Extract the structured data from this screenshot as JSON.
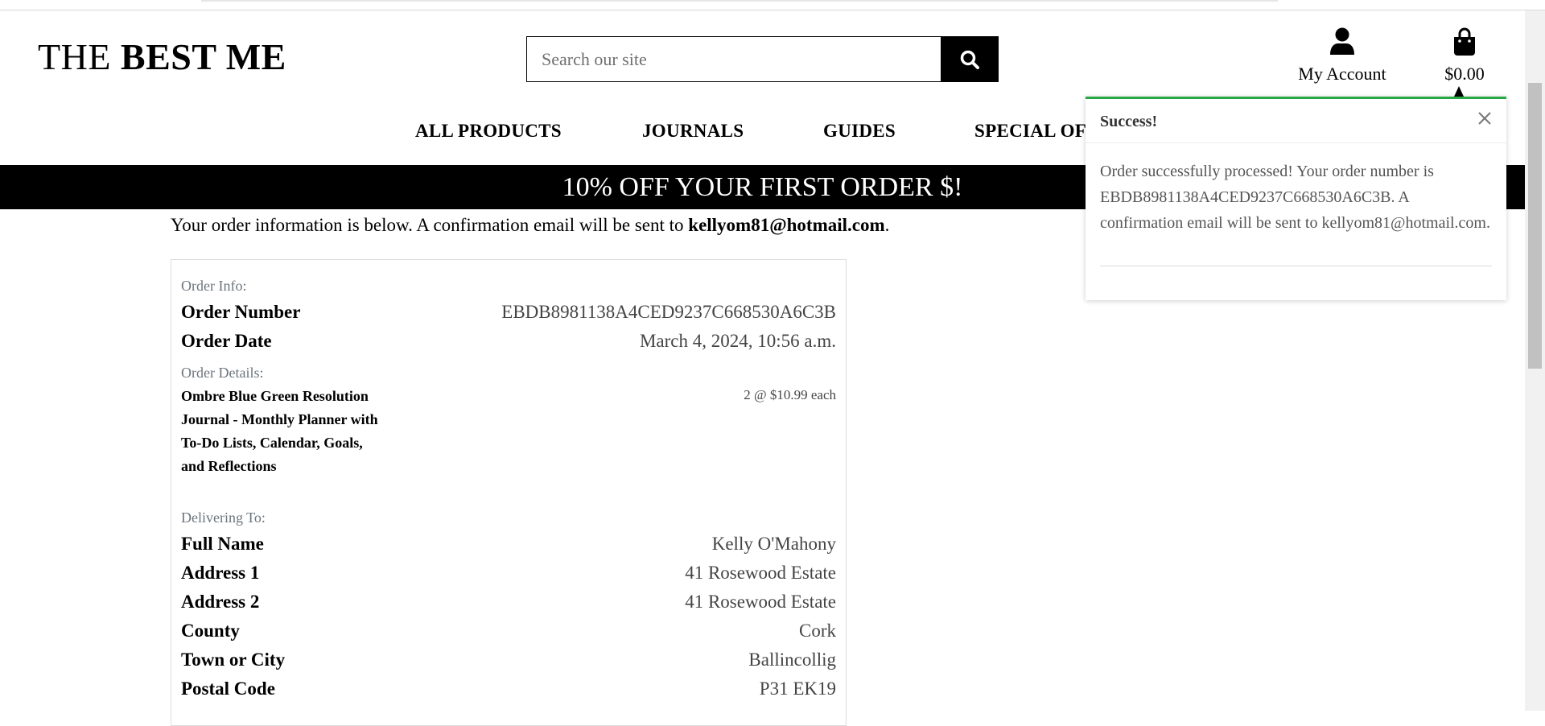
{
  "header": {
    "logo_regular": "THE ",
    "logo_bold": "BEST ME",
    "search_placeholder": "Search our site",
    "account_label": "My Account",
    "cart_total": "$0.00"
  },
  "nav": {
    "items": [
      "ALL PRODUCTS",
      "JOURNALS",
      "GUIDES",
      "SPECIAL OF"
    ]
  },
  "banner": {
    "text": "10% OFF YOUR FIRST ORDER $!"
  },
  "intro": {
    "text": "Your order information is below. A confirmation email will be sent to ",
    "email": "kellyom81@hotmail.com",
    "suffix": "."
  },
  "order": {
    "info_heading": "Order Info:",
    "number_label": "Order Number",
    "number_value": "EBDB8981138A4CED9237C668530A6C3B",
    "date_label": "Order Date",
    "date_value": "March 4, 2024, 10:56 a.m.",
    "details_heading": "Order Details:",
    "product_name": "Ombre Blue Green Resolution Journal - Monthly Planner with To-Do Lists, Calendar, Goals, and Reflections",
    "product_qty": "2 @ $10.99 each",
    "delivery_heading": "Delivering To:",
    "delivery": [
      {
        "label": "Full Name",
        "value": "Kelly O'Mahony"
      },
      {
        "label": "Address 1",
        "value": "41 Rosewood Estate"
      },
      {
        "label": "Address 2",
        "value": "41 Rosewood Estate"
      },
      {
        "label": "County",
        "value": "Cork"
      },
      {
        "label": "Town or City",
        "value": "Ballincollig"
      },
      {
        "label": "Postal Code",
        "value": "P31 EK19"
      }
    ]
  },
  "toast": {
    "title": "Success!",
    "message": "Order successfully processed! Your order number is EBDB8981138A4CED9237C668530A6C3B. A confirmation email will be sent to kellyom81@hotmail.com.",
    "accent_color": "#28a745"
  },
  "icons": {
    "search": "search-icon",
    "account": "user-icon",
    "cart": "shopping-bag-icon",
    "close": "close-icon"
  }
}
